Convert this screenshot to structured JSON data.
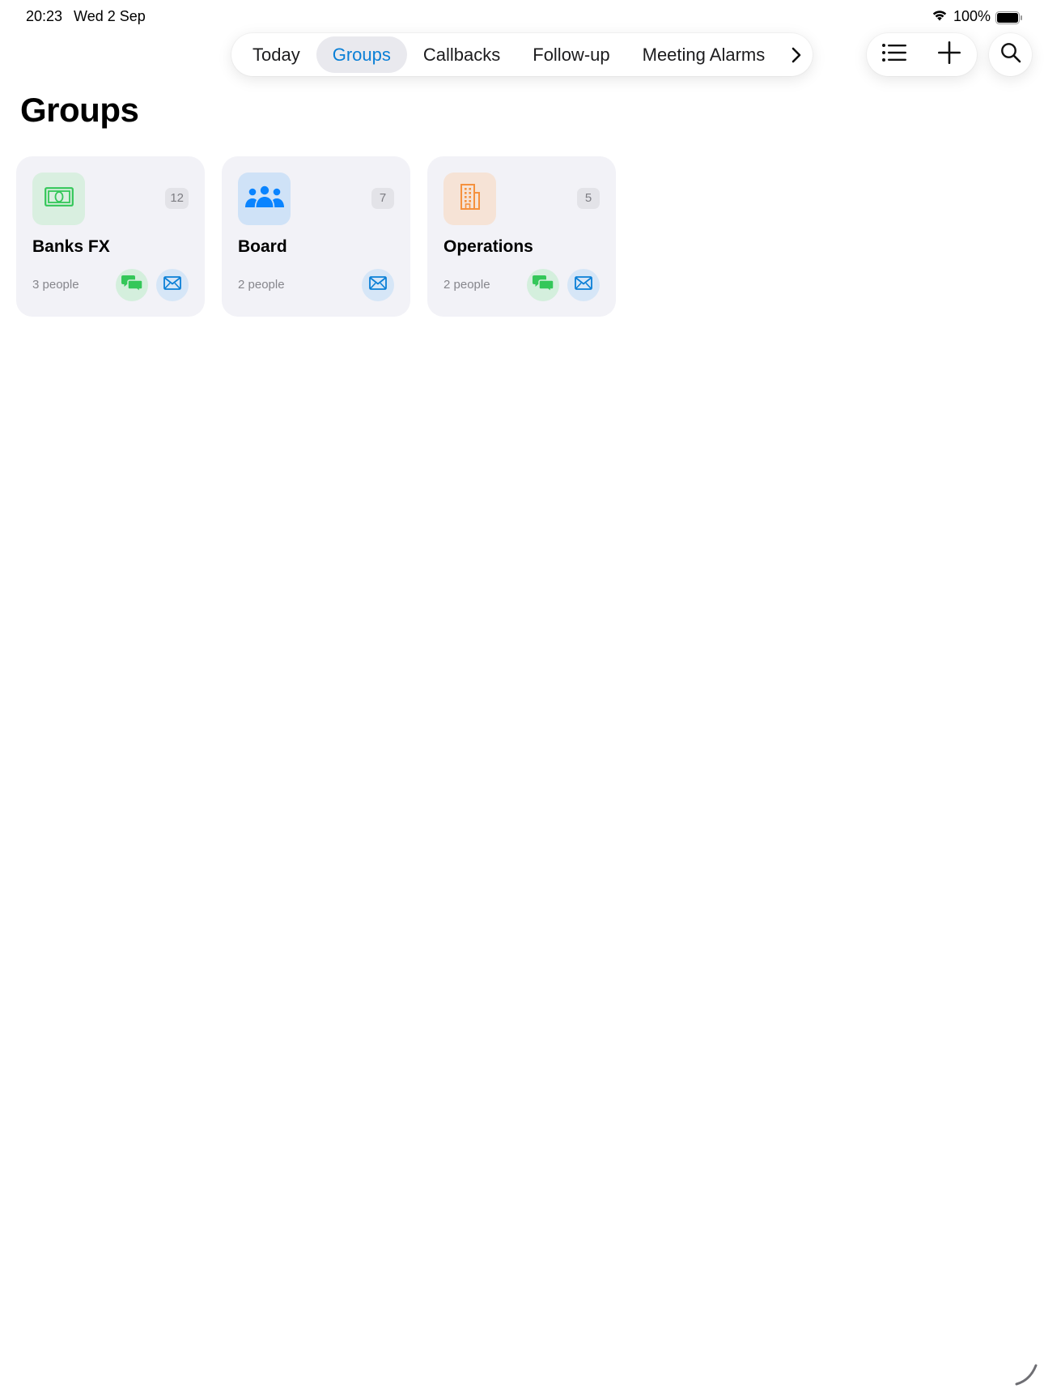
{
  "status_bar": {
    "time": "20:23",
    "date": "Wed 2 Sep",
    "battery_percent": "100%"
  },
  "tabs": [
    {
      "label": "Today",
      "active": false
    },
    {
      "label": "Groups",
      "active": true
    },
    {
      "label": "Callbacks",
      "active": false
    },
    {
      "label": "Follow-up",
      "active": false
    },
    {
      "label": "Meeting Alarms",
      "active": false
    }
  ],
  "tabs_more_icon": "chevron-right-icon",
  "actions": {
    "list_icon": "list-icon",
    "add_icon": "plus-icon",
    "search_icon": "search-icon"
  },
  "page": {
    "title": "Groups"
  },
  "groups": [
    {
      "name": "Banks FX",
      "count": "12",
      "people": "3 people",
      "icon": "banknote-icon",
      "icon_color": "#34c759",
      "icon_bg": "#d9efe0",
      "has_message": true,
      "has_mail": true
    },
    {
      "name": "Board",
      "count": "7",
      "people": "2 people",
      "icon": "people-icon",
      "icon_color": "#0a84ff",
      "icon_bg": "#cfe2f7",
      "has_message": false,
      "has_mail": true
    },
    {
      "name": "Operations",
      "count": "5",
      "people": "2 people",
      "icon": "building-icon",
      "icon_color": "#f5913e",
      "icon_bg": "#f6e3d6",
      "has_message": true,
      "has_mail": true
    }
  ],
  "colors": {
    "accent": "#0a7fd6",
    "message_green": "#34c759",
    "mail_blue": "#0a7fd6"
  }
}
